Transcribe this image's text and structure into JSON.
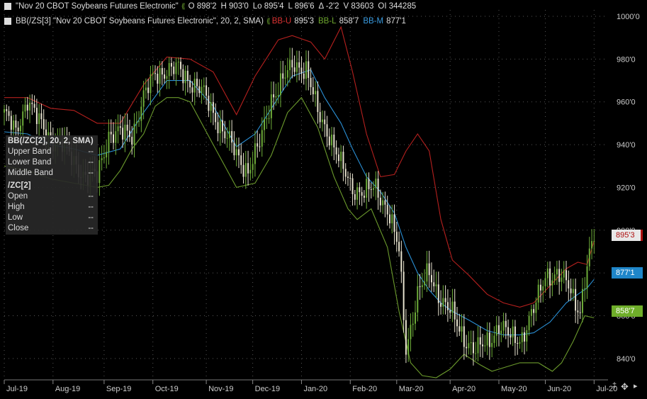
{
  "header": {
    "line1": {
      "title": "\"Nov 20 CBOT Soybeans Futures Electronic\"",
      "open": "O 898'2",
      "high": "H 903'0",
      "low": "Lo 895'4",
      "last": "L 896'6",
      "change": "Δ -2'2",
      "volume": "V 83603",
      "oi": "OI 344285"
    },
    "line2": {
      "title": "BB(/ZS[3] \"Nov 20 CBOT Soybeans Futures Electronic\", 20, 2, SMA)",
      "bbu_label": "BB-U",
      "bbu_value": "895'3",
      "bbl_label": "BB-L",
      "bbl_value": "858'7",
      "bbm_label": "BB-M",
      "bbm_value": "877'1"
    }
  },
  "info_panel": {
    "study_title": "BB(/ZC[2], 20, 2, SMA)",
    "upper_label": "Upper Band",
    "upper_value": "--",
    "lower_label": "Lower Band",
    "lower_value": "--",
    "middle_label": "Middle Band",
    "middle_value": "--",
    "symbol": "/ZC[2]",
    "open_label": "Open",
    "open_value": "--",
    "high_label": "High",
    "high_value": "--",
    "low_label": "Low",
    "low_value": "--",
    "close_label": "Close",
    "close_value": "--"
  },
  "price_tags": {
    "upper": "895'3",
    "middle": "877'1",
    "lower": "858'7"
  },
  "colors": {
    "background": "#000000",
    "up_candle": "#6fae3a",
    "down_candle": "#e9e4d0",
    "upper_band": "#b5201e",
    "lower_band": "#6b9a2c",
    "middle_band": "#2a8fd4",
    "grid": "#555555"
  },
  "chart_data": {
    "type": "candlestick",
    "title": "\"Nov 20 CBOT Soybeans Futures Electronic\"",
    "ylim": [
      830,
      1003
    ],
    "y_ticks": [
      {
        "value": 840,
        "label": "840'0"
      },
      {
        "value": 860,
        "label": "860'0"
      },
      {
        "value": 880,
        "label": "880'0"
      },
      {
        "value": 900,
        "label": "900'0"
      },
      {
        "value": 920,
        "label": "920'0"
      },
      {
        "value": 940,
        "label": "940'0"
      },
      {
        "value": 960,
        "label": "960'0"
      },
      {
        "value": 980,
        "label": "980'0"
      },
      {
        "value": 1000,
        "label": "1000'0"
      }
    ],
    "x_ticks": [
      "Jul-19",
      "Aug-19",
      "Sep-19",
      "Oct-19",
      "Nov-19",
      "Dec-19",
      "Jan-20",
      "Feb-20",
      "Mar-20",
      "Apr-20",
      "May-20",
      "Jun-20",
      "Jul-20"
    ],
    "x_tick_days": [
      0,
      21,
      43,
      64,
      87,
      107,
      128,
      149,
      169,
      192,
      213,
      233,
      254
    ],
    "closes": [
      {
        "day": 0,
        "close": 955
      },
      {
        "day": 5,
        "close": 945
      },
      {
        "day": 10,
        "close": 962
      },
      {
        "day": 15,
        "close": 950
      },
      {
        "day": 20,
        "close": 943
      },
      {
        "day": 25,
        "close": 940
      },
      {
        "day": 30,
        "close": 932
      },
      {
        "day": 35,
        "close": 925
      },
      {
        "day": 40,
        "close": 925
      },
      {
        "day": 45,
        "close": 945
      },
      {
        "day": 50,
        "close": 945
      },
      {
        "day": 55,
        "close": 945
      },
      {
        "day": 60,
        "close": 962
      },
      {
        "day": 65,
        "close": 973
      },
      {
        "day": 70,
        "close": 975
      },
      {
        "day": 75,
        "close": 975
      },
      {
        "day": 80,
        "close": 970
      },
      {
        "day": 85,
        "close": 965
      },
      {
        "day": 90,
        "close": 955
      },
      {
        "day": 95,
        "close": 945
      },
      {
        "day": 100,
        "close": 935
      },
      {
        "day": 105,
        "close": 928
      },
      {
        "day": 110,
        "close": 940
      },
      {
        "day": 115,
        "close": 962
      },
      {
        "day": 120,
        "close": 970
      },
      {
        "day": 125,
        "close": 978
      },
      {
        "day": 130,
        "close": 975
      },
      {
        "day": 135,
        "close": 955
      },
      {
        "day": 140,
        "close": 945
      },
      {
        "day": 145,
        "close": 930
      },
      {
        "day": 150,
        "close": 920
      },
      {
        "day": 155,
        "close": 917
      },
      {
        "day": 160,
        "close": 920
      },
      {
        "day": 165,
        "close": 910
      },
      {
        "day": 170,
        "close": 890
      },
      {
        "day": 173,
        "close": 845
      },
      {
        "day": 178,
        "close": 870
      },
      {
        "day": 183,
        "close": 880
      },
      {
        "day": 188,
        "close": 868
      },
      {
        "day": 193,
        "close": 860
      },
      {
        "day": 198,
        "close": 850
      },
      {
        "day": 203,
        "close": 843
      },
      {
        "day": 208,
        "close": 848
      },
      {
        "day": 213,
        "close": 855
      },
      {
        "day": 218,
        "close": 850
      },
      {
        "day": 223,
        "close": 850
      },
      {
        "day": 228,
        "close": 862
      },
      {
        "day": 233,
        "close": 880
      },
      {
        "day": 238,
        "close": 878
      },
      {
        "day": 243,
        "close": 875
      },
      {
        "day": 248,
        "close": 862
      },
      {
        "day": 251,
        "close": 882
      },
      {
        "day": 254,
        "close": 897
      }
    ],
    "upper_band": [
      {
        "day": 0,
        "value": 962
      },
      {
        "day": 10,
        "value": 962
      },
      {
        "day": 20,
        "value": 957
      },
      {
        "day": 30,
        "value": 956
      },
      {
        "day": 40,
        "value": 950
      },
      {
        "day": 50,
        "value": 950
      },
      {
        "day": 60,
        "value": 968
      },
      {
        "day": 70,
        "value": 981
      },
      {
        "day": 80,
        "value": 980
      },
      {
        "day": 90,
        "value": 974
      },
      {
        "day": 100,
        "value": 954
      },
      {
        "day": 108,
        "value": 972
      },
      {
        "day": 118,
        "value": 989
      },
      {
        "day": 124,
        "value": 991
      },
      {
        "day": 132,
        "value": 988
      },
      {
        "day": 138,
        "value": 980
      },
      {
        "day": 145,
        "value": 995
      },
      {
        "day": 150,
        "value": 974
      },
      {
        "day": 156,
        "value": 945
      },
      {
        "day": 162,
        "value": 925
      },
      {
        "day": 168,
        "value": 926
      },
      {
        "day": 173,
        "value": 937
      },
      {
        "day": 178,
        "value": 945
      },
      {
        "day": 183,
        "value": 937
      },
      {
        "day": 188,
        "value": 905
      },
      {
        "day": 193,
        "value": 886
      },
      {
        "day": 200,
        "value": 879
      },
      {
        "day": 208,
        "value": 870
      },
      {
        "day": 215,
        "value": 866
      },
      {
        "day": 222,
        "value": 864
      },
      {
        "day": 228,
        "value": 866
      },
      {
        "day": 235,
        "value": 874
      },
      {
        "day": 242,
        "value": 882
      },
      {
        "day": 247,
        "value": 885
      },
      {
        "day": 251,
        "value": 884
      },
      {
        "day": 254,
        "value": 895
      }
    ],
    "lower_band": [
      {
        "day": 0,
        "value": 930
      },
      {
        "day": 10,
        "value": 928
      },
      {
        "day": 20,
        "value": 924
      },
      {
        "day": 30,
        "value": 922
      },
      {
        "day": 40,
        "value": 920
      },
      {
        "day": 45,
        "value": 921
      },
      {
        "day": 50,
        "value": 928
      },
      {
        "day": 55,
        "value": 938
      },
      {
        "day": 60,
        "value": 945
      },
      {
        "day": 65,
        "value": 958
      },
      {
        "day": 70,
        "value": 962
      },
      {
        "day": 75,
        "value": 962
      },
      {
        "day": 80,
        "value": 960
      },
      {
        "day": 90,
        "value": 940
      },
      {
        "day": 100,
        "value": 920
      },
      {
        "day": 108,
        "value": 922
      },
      {
        "day": 115,
        "value": 935
      },
      {
        "day": 122,
        "value": 955
      },
      {
        "day": 128,
        "value": 962
      },
      {
        "day": 135,
        "value": 948
      },
      {
        "day": 142,
        "value": 925
      },
      {
        "day": 148,
        "value": 910
      },
      {
        "day": 152,
        "value": 905
      },
      {
        "day": 158,
        "value": 910
      },
      {
        "day": 165,
        "value": 892
      },
      {
        "day": 170,
        "value": 862
      },
      {
        "day": 175,
        "value": 838
      },
      {
        "day": 180,
        "value": 832
      },
      {
        "day": 186,
        "value": 831
      },
      {
        "day": 192,
        "value": 835
      },
      {
        "day": 198,
        "value": 842
      },
      {
        "day": 205,
        "value": 837
      },
      {
        "day": 210,
        "value": 834
      },
      {
        "day": 216,
        "value": 836
      },
      {
        "day": 222,
        "value": 838
      },
      {
        "day": 230,
        "value": 838
      },
      {
        "day": 236,
        "value": 834
      },
      {
        "day": 240,
        "value": 838
      },
      {
        "day": 245,
        "value": 848
      },
      {
        "day": 250,
        "value": 860
      },
      {
        "day": 254,
        "value": 859
      }
    ],
    "middle_band": [
      {
        "day": 0,
        "value": 946
      },
      {
        "day": 10,
        "value": 945
      },
      {
        "day": 20,
        "value": 940
      },
      {
        "day": 30,
        "value": 938
      },
      {
        "day": 40,
        "value": 935
      },
      {
        "day": 50,
        "value": 938
      },
      {
        "day": 60,
        "value": 955
      },
      {
        "day": 70,
        "value": 970
      },
      {
        "day": 80,
        "value": 970
      },
      {
        "day": 90,
        "value": 958
      },
      {
        "day": 100,
        "value": 939
      },
      {
        "day": 108,
        "value": 945
      },
      {
        "day": 118,
        "value": 962
      },
      {
        "day": 124,
        "value": 972
      },
      {
        "day": 132,
        "value": 975
      },
      {
        "day": 138,
        "value": 962
      },
      {
        "day": 145,
        "value": 950
      },
      {
        "day": 150,
        "value": 938
      },
      {
        "day": 156,
        "value": 925
      },
      {
        "day": 162,
        "value": 918
      },
      {
        "day": 168,
        "value": 908
      },
      {
        "day": 173,
        "value": 892
      },
      {
        "day": 178,
        "value": 880
      },
      {
        "day": 183,
        "value": 872
      },
      {
        "day": 188,
        "value": 866
      },
      {
        "day": 193,
        "value": 862
      },
      {
        "day": 200,
        "value": 858
      },
      {
        "day": 208,
        "value": 853
      },
      {
        "day": 215,
        "value": 851
      },
      {
        "day": 222,
        "value": 851
      },
      {
        "day": 228,
        "value": 852
      },
      {
        "day": 235,
        "value": 857
      },
      {
        "day": 242,
        "value": 866
      },
      {
        "day": 247,
        "value": 870
      },
      {
        "day": 251,
        "value": 873
      },
      {
        "day": 254,
        "value": 877
      }
    ]
  }
}
